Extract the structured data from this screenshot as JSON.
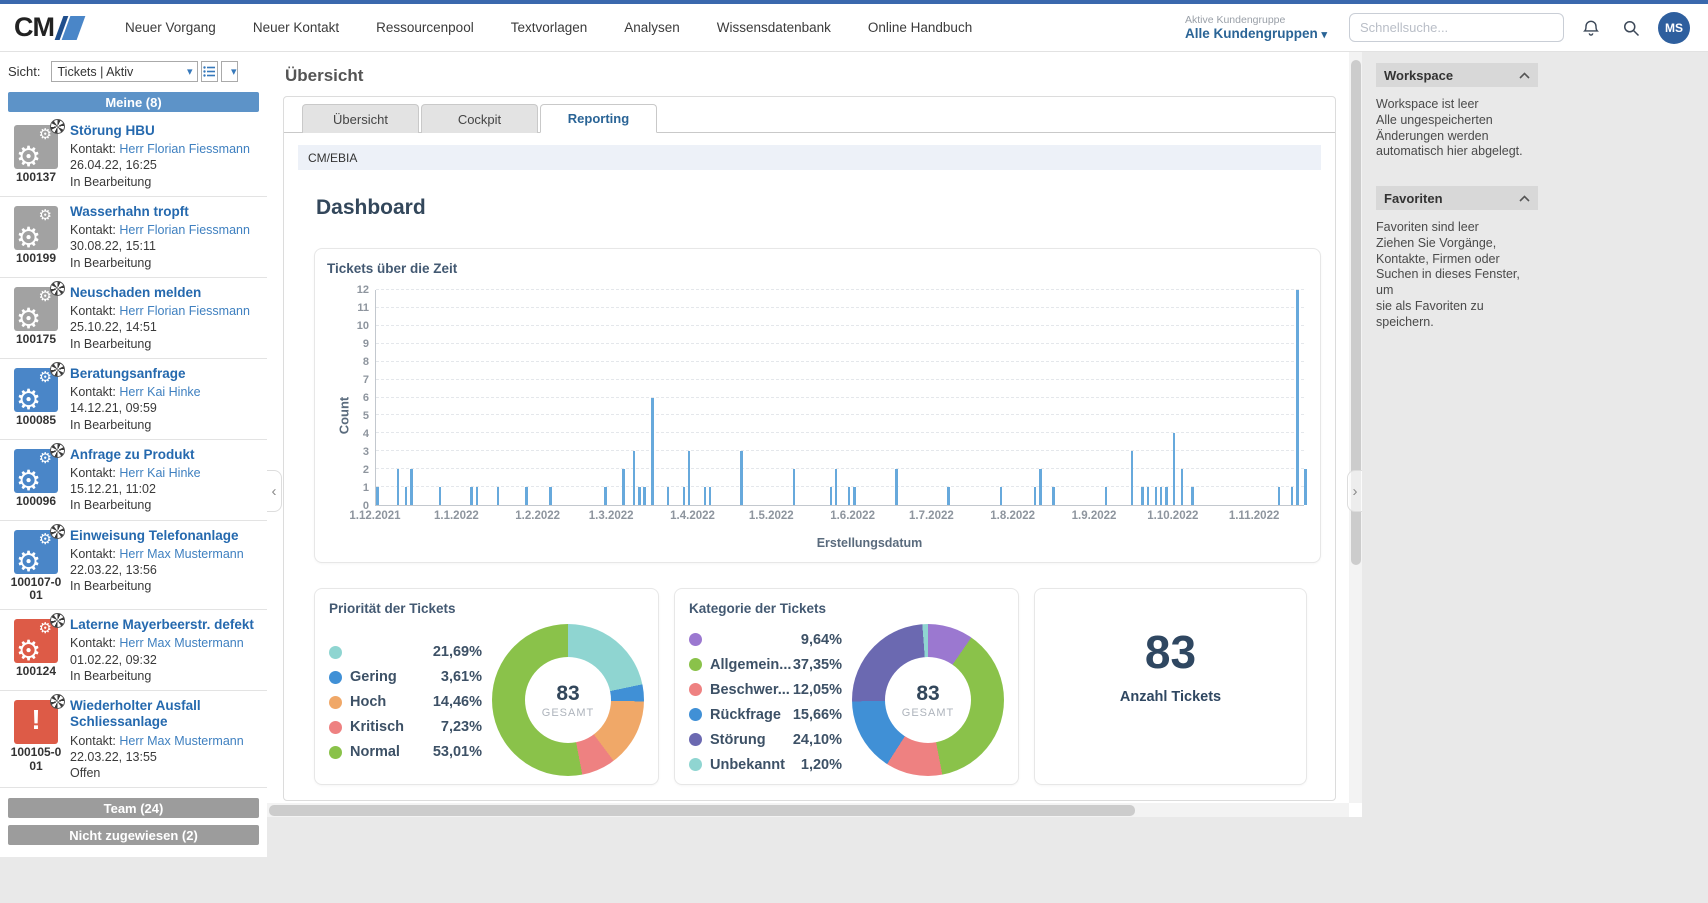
{
  "nav": {
    "logo_text": "CM",
    "items": [
      "Neuer Vorgang",
      "Neuer Kontakt",
      "Ressourcenpool",
      "Textvorlagen",
      "Analysen",
      "Wissensdatenbank",
      "Online Handbuch"
    ],
    "customer_group_label": "Aktive Kundengruppe",
    "customer_group_value": "Alle Kundengruppen",
    "customer_group_caret": "▾",
    "search_placeholder": "Schnellsuche...",
    "avatar_initials": "MS"
  },
  "sidebar": {
    "view_label": "Sicht:",
    "view_value": "Tickets | Aktiv",
    "caret": "▾",
    "groups": {
      "mine": "Meine (8)",
      "team": "Team (24)",
      "unassigned": "Nicht zugewiesen (2)"
    },
    "contact_prefix": "Kontakt: ",
    "icon_colors": {
      "gray": "#a2a2a2",
      "blue": "#4a86c8",
      "red": "#dd5b47"
    },
    "tickets": [
      {
        "id": "100137",
        "title": "Störung HBU",
        "contact": "Herr Florian Fiessmann",
        "date": "26.04.22, 16:25",
        "status": "In Bearbeitung",
        "color": "gray",
        "glyph": "gears",
        "badge": true
      },
      {
        "id": "100199",
        "title": "Wasserhahn tropft",
        "contact": "Herr Florian Fiessmann",
        "date": "30.08.22, 15:11",
        "status": "In Bearbeitung",
        "color": "gray",
        "glyph": "gears",
        "badge": false
      },
      {
        "id": "100175",
        "title": "Neuschaden melden",
        "contact": "Herr Florian Fiessmann",
        "date": "25.10.22, 14:51",
        "status": "In Bearbeitung",
        "color": "gray",
        "glyph": "gears",
        "badge": true
      },
      {
        "id": "100085",
        "title": "Beratungsanfrage",
        "contact": "Herr Kai Hinke",
        "date": "14.12.21, 09:59",
        "status": "In Bearbeitung",
        "color": "blue",
        "glyph": "gears",
        "badge": true
      },
      {
        "id": "100096",
        "title": "Anfrage zu Produkt",
        "contact": "Herr Kai Hinke",
        "date": "15.12.21, 11:02",
        "status": "In Bearbeitung",
        "color": "blue",
        "glyph": "gears",
        "badge": true
      },
      {
        "id": "100107-001",
        "title": "Einweisung Telefonanlage",
        "contact": "Herr Max Mustermann",
        "date": "22.03.22, 13:56",
        "status": "In Bearbeitung",
        "color": "blue",
        "glyph": "gears",
        "badge": true
      },
      {
        "id": "100124",
        "title": "Laterne Mayerbeerstr. defekt",
        "contact": "Herr Max Mustermann",
        "date": "01.02.22, 09:32",
        "status": "In Bearbeitung",
        "color": "red",
        "glyph": "gears",
        "badge": true
      },
      {
        "id": "100105-001",
        "title": "Wiederholter Ausfall Schliessanlage",
        "contact": "Herr Max Mustermann",
        "date": "22.03.22, 13:55",
        "status": "Offen",
        "color": "red",
        "glyph": "exclamation",
        "badge": true
      }
    ]
  },
  "main": {
    "page_title": "Übersicht",
    "tabs": [
      {
        "label": "Übersicht",
        "active": false
      },
      {
        "label": "Cockpit",
        "active": false
      },
      {
        "label": "Reporting",
        "active": true
      }
    ],
    "breadcrumb": "CM/EBIA",
    "dashboard_title": "Dashboard"
  },
  "chart_data": [
    {
      "type": "bar",
      "title": "Tickets über die Zeit",
      "xlabel": "Erstellungsdatum",
      "ylabel": "Count",
      "ylim": [
        0,
        12
      ],
      "yticks": [
        0,
        1,
        2,
        3,
        4,
        5,
        6,
        7,
        8,
        9,
        10,
        11,
        12
      ],
      "grid": true,
      "bar_color": "#67a9dc",
      "x_domain_days": 354,
      "x_ticks": [
        {
          "label": "1.12.2021",
          "frac": 0.0
        },
        {
          "label": "1.1.2022",
          "frac": 0.0876
        },
        {
          "label": "1.2.2022",
          "frac": 0.1751
        },
        {
          "label": "1.3.2022",
          "frac": 0.2542
        },
        {
          "label": "1.4.2022",
          "frac": 0.3418
        },
        {
          "label": "1.5.2022",
          "frac": 0.4266
        },
        {
          "label": "1.6.2022",
          "frac": 0.5141
        },
        {
          "label": "1.7.2022",
          "frac": 0.5989
        },
        {
          "label": "1.8.2022",
          "frac": 0.6864
        },
        {
          "label": "1.9.2022",
          "frac": 0.774
        },
        {
          "label": "1.10.2022",
          "frac": 0.8588
        },
        {
          "label": "1.11.2022",
          "frac": 0.9463
        }
      ],
      "bars": [
        [
          0,
          1
        ],
        [
          8,
          2
        ],
        [
          11,
          1
        ],
        [
          13,
          2
        ],
        [
          24,
          1
        ],
        [
          36,
          1
        ],
        [
          38,
          1
        ],
        [
          46,
          1
        ],
        [
          57,
          1
        ],
        [
          66,
          1
        ],
        [
          87,
          1
        ],
        [
          94,
          2
        ],
        [
          98,
          3
        ],
        [
          100,
          1
        ],
        [
          102,
          1
        ],
        [
          105,
          6
        ],
        [
          111,
          1
        ],
        [
          117,
          1
        ],
        [
          119,
          3
        ],
        [
          125,
          1
        ],
        [
          127,
          1
        ],
        [
          139,
          3
        ],
        [
          159,
          2
        ],
        [
          173,
          1
        ],
        [
          175,
          2
        ],
        [
          180,
          1
        ],
        [
          182,
          1
        ],
        [
          198,
          2
        ],
        [
          218,
          1
        ],
        [
          238,
          1
        ],
        [
          251,
          1
        ],
        [
          253,
          2
        ],
        [
          258,
          1
        ],
        [
          278,
          1
        ],
        [
          288,
          3
        ],
        [
          292,
          1
        ],
        [
          294,
          1
        ],
        [
          297,
          1
        ],
        [
          299,
          1
        ],
        [
          301,
          1
        ],
        [
          304,
          4
        ],
        [
          307,
          2
        ],
        [
          311,
          1
        ],
        [
          344,
          1
        ],
        [
          349,
          1
        ],
        [
          351,
          12
        ],
        [
          354,
          2
        ]
      ]
    },
    {
      "type": "donut",
      "title": "Priorität der Tickets",
      "center_value": "83",
      "center_label": "GESAMT",
      "legend_position": "left",
      "slices": [
        {
          "label": "",
          "pct_label": "21,69%",
          "value": 21.69,
          "color": "#8fd5d1"
        },
        {
          "label": "Gering",
          "pct_label": "3,61%",
          "value": 3.61,
          "color": "#4090d6"
        },
        {
          "label": "Hoch",
          "pct_label": "14,46%",
          "value": 14.46,
          "color": "#f0a868"
        },
        {
          "label": "Kritisch",
          "pct_label": "7,23%",
          "value": 7.23,
          "color": "#ee8181"
        },
        {
          "label": "Normal",
          "pct_label": "53,01%",
          "value": 53.01,
          "color": "#8ac24a"
        }
      ]
    },
    {
      "type": "donut",
      "title": "Kategorie der Tickets",
      "center_value": "83",
      "center_label": "GESAMT",
      "legend_position": "left",
      "slices": [
        {
          "label": "",
          "pct_label": "9,64%",
          "value": 9.64,
          "color": "#9b78d0"
        },
        {
          "label": "Allgemein...",
          "pct_label": "37,35%",
          "value": 37.35,
          "color": "#8ac24a"
        },
        {
          "label": "Beschwer...",
          "pct_label": "12,05%",
          "value": 12.05,
          "color": "#ee8181"
        },
        {
          "label": "Rückfrage",
          "pct_label": "15,66%",
          "value": 15.66,
          "color": "#4090d6"
        },
        {
          "label": "Störung",
          "pct_label": "24,10%",
          "value": 24.1,
          "color": "#6b69b1"
        },
        {
          "label": "Unbekannt",
          "pct_label": "1,20%",
          "value": 1.2,
          "color": "#8fd5d1"
        }
      ]
    },
    {
      "type": "count",
      "value": "83",
      "label": "Anzahl Tickets"
    }
  ],
  "right_panel": {
    "workspace": {
      "title": "Workspace",
      "lines": [
        "Workspace ist leer",
        "Alle ungespeicherten",
        "Änderungen werden",
        "automatisch hier abgelegt."
      ]
    },
    "favorites": {
      "title": "Favoriten",
      "lines": [
        "Favoriten sind leer",
        "Ziehen Sie Vorgänge,",
        "Kontakte, Firmen oder",
        "Suchen in dieses Fenster, um",
        "sie als Favoriten zu",
        "speichern."
      ]
    }
  }
}
